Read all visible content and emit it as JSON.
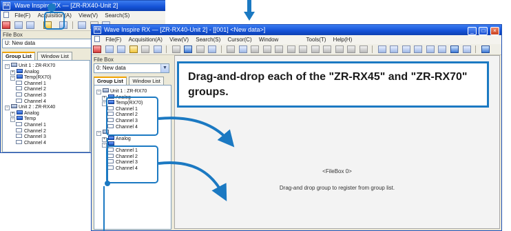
{
  "instruction": "Drag-and-drop each of the \"ZR-RX45\" and \"ZR-RX70\" groups.",
  "back_window": {
    "title": "Wave Inspire RX — [ZR-RX40-Unit 2]",
    "menus": [
      "File(F)",
      "Acquisition(A)",
      "View(V)",
      "Search(S)"
    ],
    "file_box_label": "File Box",
    "combo_value": "U: New data",
    "tabs": [
      "Group List",
      "Window List"
    ],
    "tree": [
      {
        "level": 0,
        "kind": "unit",
        "expander": "−",
        "label": "Unit 1 : ZR-RX70"
      },
      {
        "level": 1,
        "kind": "group",
        "expander": "+",
        "label": "Analog"
      },
      {
        "level": 1,
        "kind": "group",
        "expander": "−",
        "label": "Temp(RX70)"
      },
      {
        "level": 2,
        "kind": "channel",
        "expander": "",
        "label": "Channel 1"
      },
      {
        "level": 2,
        "kind": "channel",
        "expander": "",
        "label": "Channel 2"
      },
      {
        "level": 2,
        "kind": "channel",
        "expander": "",
        "label": "Channel 3"
      },
      {
        "level": 2,
        "kind": "channel",
        "expander": "",
        "label": "Channel 4"
      },
      {
        "level": 0,
        "kind": "unit",
        "expander": "−",
        "label": "Unit 2 : ZR-RX40"
      },
      {
        "level": 1,
        "kind": "group",
        "expander": "+",
        "label": "Analog"
      },
      {
        "level": 1,
        "kind": "group",
        "expander": "−",
        "label": "Temp"
      },
      {
        "level": 2,
        "kind": "channel",
        "expander": "",
        "label": "Channel 1"
      },
      {
        "level": 2,
        "kind": "channel",
        "expander": "",
        "label": "Channel 2"
      },
      {
        "level": 2,
        "kind": "channel",
        "expander": "",
        "label": "Channel 3"
      },
      {
        "level": 2,
        "kind": "channel",
        "expander": "",
        "label": "Channel 4"
      }
    ]
  },
  "front_window": {
    "title": "Wave Inspire RX — [ZR-RX40-Unit 2] - [[001] <New data>]",
    "menus": [
      "File(F)",
      "Acquisition(A)",
      "View(V)",
      "Search(S)",
      "Cursor(C)",
      "Window",
      "Tools(T)",
      "Help(H)"
    ],
    "window_buttons": {
      "minimize": "_",
      "maximize": "□",
      "close": "×"
    },
    "mdi_buttons": "_ ✕",
    "file_box_label": "File Box",
    "combo_value": "0: New data",
    "tabs": [
      "Group List",
      "Window List"
    ],
    "tree": [
      {
        "level": 0,
        "kind": "unit",
        "expander": "−",
        "label": "Unit 1 : ZR-RX70"
      },
      {
        "level": 1,
        "kind": "group",
        "expander": "+",
        "label": "Analog"
      },
      {
        "level": 1,
        "kind": "group",
        "expander": "−",
        "label": "Temp(RX70)"
      },
      {
        "level": 2,
        "kind": "channel",
        "expander": "",
        "label": "Channel 1"
      },
      {
        "level": 2,
        "kind": "channel",
        "expander": "",
        "label": "Channel 2"
      },
      {
        "level": 2,
        "kind": "channel",
        "expander": "",
        "label": "Channel 3"
      },
      {
        "level": 2,
        "kind": "channel",
        "expander": "",
        "label": "Channel 4"
      },
      {
        "level": 0,
        "kind": "unit",
        "expander": "−",
        "label": ""
      },
      {
        "level": 1,
        "kind": "group",
        "expander": "+",
        "label": "Analog"
      },
      {
        "level": 1,
        "kind": "group",
        "expander": "−",
        "label": ""
      },
      {
        "level": 2,
        "kind": "channel",
        "expander": "",
        "label": "Channel 1"
      },
      {
        "level": 2,
        "kind": "channel",
        "expander": "",
        "label": "Channel 2"
      },
      {
        "level": 2,
        "kind": "channel",
        "expander": "",
        "label": "Channel 3"
      },
      {
        "level": 2,
        "kind": "channel",
        "expander": "",
        "label": "Channel 4"
      }
    ],
    "filebox_title": "<FileBox 0>",
    "filebox_message": "Drag-and drop group to register from group list."
  },
  "colors": {
    "accent": "#1b79c2",
    "titlebar": "#1451d6",
    "window_bg": "#ece9d8"
  }
}
